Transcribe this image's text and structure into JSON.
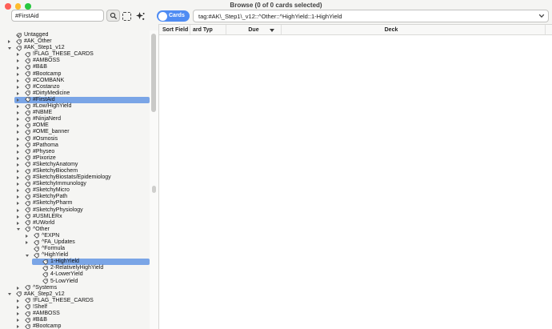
{
  "window": {
    "title": "Browse (0 of 0 cards selected)"
  },
  "colors": {
    "accent": "#4f8cf3",
    "selection": "#7aa5e6",
    "window-bg": "#f5f5f3",
    "traffic-red": "#ff5f57",
    "traffic-yellow": "#febc2e",
    "traffic-green": "#28c840"
  },
  "toolbar": {
    "filter_value": "#FirstAid",
    "filter_placeholder": "",
    "icons": [
      "search-icon",
      "select-area-icon",
      "sparkle-icon"
    ],
    "cards_toggle_label": "Cards",
    "search_value": "tag:#AK\\_Step1\\_v12::^Other::^HighYield::1-HighYield",
    "combo_chevron": "chevron-down-icon"
  },
  "table": {
    "columns": [
      {
        "label": "Sort Field",
        "sort": false
      },
      {
        "label": "ard Typ",
        "sort": false
      },
      {
        "label": "Due",
        "sort": true
      },
      {
        "label": "Deck",
        "sort": false
      }
    ]
  },
  "sidebar": {
    "items": [
      {
        "label": "Untagged",
        "level": 0,
        "state": "none",
        "icon": "untagged",
        "selected": false
      },
      {
        "label": "#AK_Other",
        "level": 0,
        "state": "collapsed",
        "icon": "tag",
        "selected": false
      },
      {
        "label": "#AK_Step1_v12",
        "level": 0,
        "state": "expanded",
        "icon": "tag",
        "selected": false
      },
      {
        "label": "!FLAG_THESE_CARDS",
        "level": 1,
        "state": "collapsed",
        "icon": "tag",
        "selected": false
      },
      {
        "label": "#AMBOSS",
        "level": 1,
        "state": "collapsed",
        "icon": "tag",
        "selected": false
      },
      {
        "label": "#B&B",
        "level": 1,
        "state": "collapsed",
        "icon": "tag",
        "selected": false
      },
      {
        "label": "#Bootcamp",
        "level": 1,
        "state": "collapsed",
        "icon": "tag",
        "selected": false
      },
      {
        "label": "#COMBANK",
        "level": 1,
        "state": "collapsed",
        "icon": "tag",
        "selected": false
      },
      {
        "label": "#Costanzo",
        "level": 1,
        "state": "collapsed",
        "icon": "tag",
        "selected": false
      },
      {
        "label": "#DirtyMedicine",
        "level": 1,
        "state": "collapsed",
        "icon": "tag",
        "selected": false
      },
      {
        "label": "#FirstAid",
        "level": 1,
        "state": "collapsed",
        "icon": "tag",
        "selected": true
      },
      {
        "label": "#Low/HighYield",
        "level": 1,
        "state": "collapsed",
        "icon": "tag",
        "selected": false
      },
      {
        "label": "#NBME",
        "level": 1,
        "state": "collapsed",
        "icon": "tag",
        "selected": false
      },
      {
        "label": "#NinjaNerd",
        "level": 1,
        "state": "collapsed",
        "icon": "tag",
        "selected": false
      },
      {
        "label": "#OME",
        "level": 1,
        "state": "collapsed",
        "icon": "tag",
        "selected": false
      },
      {
        "label": "#OME_banner",
        "level": 1,
        "state": "collapsed",
        "icon": "tag",
        "selected": false
      },
      {
        "label": "#Osmosis",
        "level": 1,
        "state": "collapsed",
        "icon": "tag",
        "selected": false
      },
      {
        "label": "#Pathoma",
        "level": 1,
        "state": "collapsed",
        "icon": "tag",
        "selected": false
      },
      {
        "label": "#Physeo",
        "level": 1,
        "state": "collapsed",
        "icon": "tag",
        "selected": false
      },
      {
        "label": "#Pixorize",
        "level": 1,
        "state": "collapsed",
        "icon": "tag",
        "selected": false
      },
      {
        "label": "#SketchyAnatomy",
        "level": 1,
        "state": "collapsed",
        "icon": "tag",
        "selected": false
      },
      {
        "label": "#SketchyBiochem",
        "level": 1,
        "state": "collapsed",
        "icon": "tag",
        "selected": false
      },
      {
        "label": "#SketchyBiostats/Epidemiology",
        "level": 1,
        "state": "collapsed",
        "icon": "tag",
        "selected": false
      },
      {
        "label": "#SketchyImmunology",
        "level": 1,
        "state": "collapsed",
        "icon": "tag",
        "selected": false
      },
      {
        "label": "#SketchyMicro",
        "level": 1,
        "state": "collapsed",
        "icon": "tag",
        "selected": false
      },
      {
        "label": "#SketchyPath",
        "level": 1,
        "state": "collapsed",
        "icon": "tag",
        "selected": false
      },
      {
        "label": "#SketchyPharm",
        "level": 1,
        "state": "collapsed",
        "icon": "tag",
        "selected": false
      },
      {
        "label": "#SketchyPhysiology",
        "level": 1,
        "state": "collapsed",
        "icon": "tag",
        "selected": false
      },
      {
        "label": "#USMLERx",
        "level": 1,
        "state": "collapsed",
        "icon": "tag",
        "selected": false
      },
      {
        "label": "#UWorld",
        "level": 1,
        "state": "collapsed",
        "icon": "tag",
        "selected": false
      },
      {
        "label": "^Other",
        "level": 1,
        "state": "expanded",
        "icon": "tag",
        "selected": false
      },
      {
        "label": "^EXPN",
        "level": 2,
        "state": "collapsed",
        "icon": "tag",
        "selected": false
      },
      {
        "label": "^FA_Updates",
        "level": 2,
        "state": "collapsed",
        "icon": "tag",
        "selected": false
      },
      {
        "label": "^Formula",
        "level": 2,
        "state": "none",
        "icon": "tag",
        "selected": false
      },
      {
        "label": "^HighYield",
        "level": 2,
        "state": "expanded",
        "icon": "tag",
        "selected": false
      },
      {
        "label": "1-HighYield",
        "level": 3,
        "state": "none",
        "icon": "tag",
        "selected": true
      },
      {
        "label": "2-RelativelyHighYield",
        "level": 3,
        "state": "none",
        "icon": "tag",
        "selected": false
      },
      {
        "label": "4-LowerYield",
        "level": 3,
        "state": "none",
        "icon": "tag",
        "selected": false
      },
      {
        "label": "5-LowYield",
        "level": 3,
        "state": "none",
        "icon": "tag",
        "selected": false
      },
      {
        "label": "^Systems",
        "level": 1,
        "state": "collapsed",
        "icon": "tag",
        "selected": false
      },
      {
        "label": "#AK_Step2_v12",
        "level": 0,
        "state": "expanded",
        "icon": "tag",
        "selected": false
      },
      {
        "label": "!FLAG_THESE_CARDS",
        "level": 1,
        "state": "collapsed",
        "icon": "tag",
        "selected": false
      },
      {
        "label": "!Shelf",
        "level": 1,
        "state": "collapsed",
        "icon": "tag",
        "selected": false
      },
      {
        "label": "#AMBOSS",
        "level": 1,
        "state": "collapsed",
        "icon": "tag",
        "selected": false
      },
      {
        "label": "#B&B",
        "level": 1,
        "state": "collapsed",
        "icon": "tag",
        "selected": false
      },
      {
        "label": "#Bootcamp",
        "level": 1,
        "state": "collapsed",
        "icon": "tag",
        "selected": false
      }
    ]
  }
}
